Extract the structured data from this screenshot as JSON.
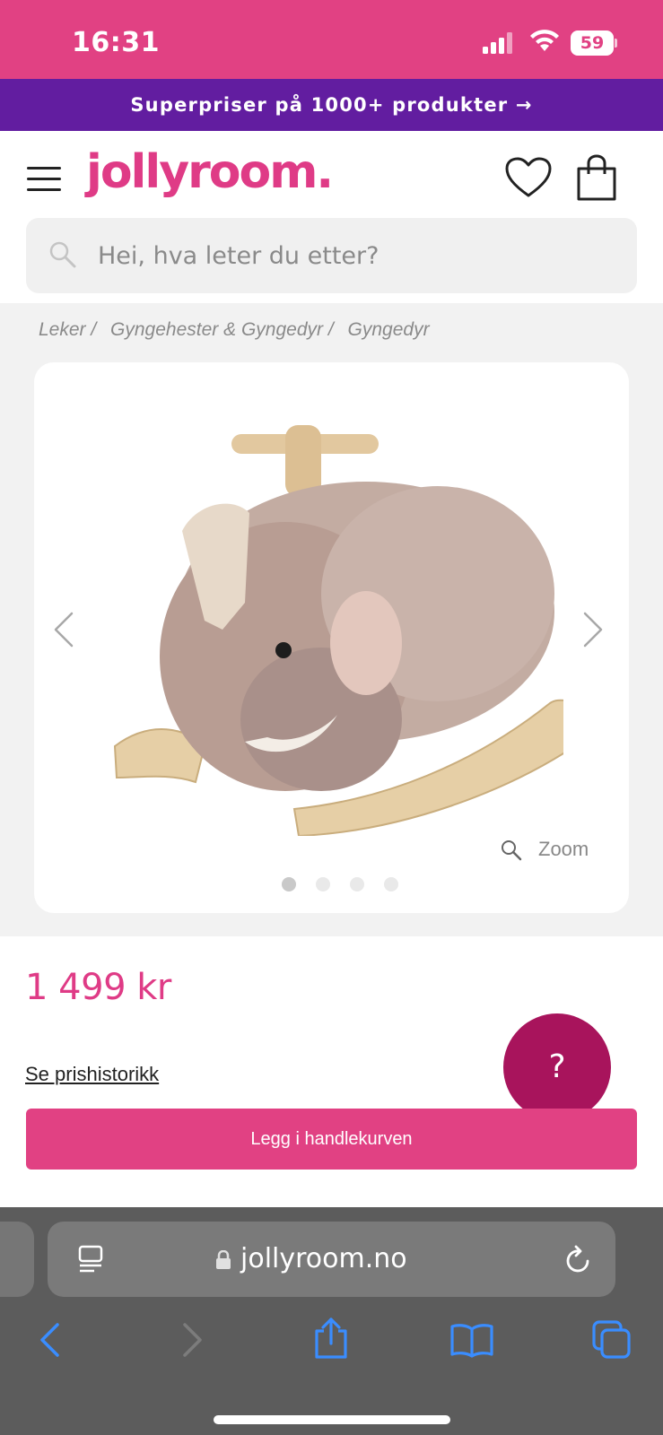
{
  "status_bar": {
    "time": "16:31",
    "battery": "59",
    "icons": [
      "signal-icon",
      "wifi-icon",
      "battery-icon"
    ]
  },
  "promo": {
    "text": "Superpriser på 1000+ produkter →"
  },
  "header": {
    "logo": "jollyroom.",
    "search_placeholder": "Hei, hva leter du etter?",
    "icons": [
      "menu-icon",
      "heart-icon",
      "bag-icon",
      "search-icon"
    ]
  },
  "breadcrumb": {
    "items": [
      "Leker /",
      "Gyngehester & Gyngedyr /",
      "Gyngedyr"
    ]
  },
  "gallery": {
    "zoom_label": "Zoom",
    "image_count": 4,
    "active_index": 0
  },
  "product": {
    "price": "1 499 kr",
    "price_history_link": "Se prishistorikk",
    "add_to_cart_label": "Legg i handlekurven",
    "help_label": "?"
  },
  "browser": {
    "url": "jollyroom.no",
    "icons": [
      "reader-icon",
      "lock-icon",
      "reload-icon",
      "back-icon",
      "forward-icon",
      "share-icon",
      "bookmarks-icon",
      "tabs-icon"
    ]
  },
  "colors": {
    "brand_pink": "#e14183",
    "promo_purple": "#621da0",
    "help_button": "#a8145c",
    "browser_gray": "#5c5c5c",
    "ios_blue": "#3a8dff"
  }
}
